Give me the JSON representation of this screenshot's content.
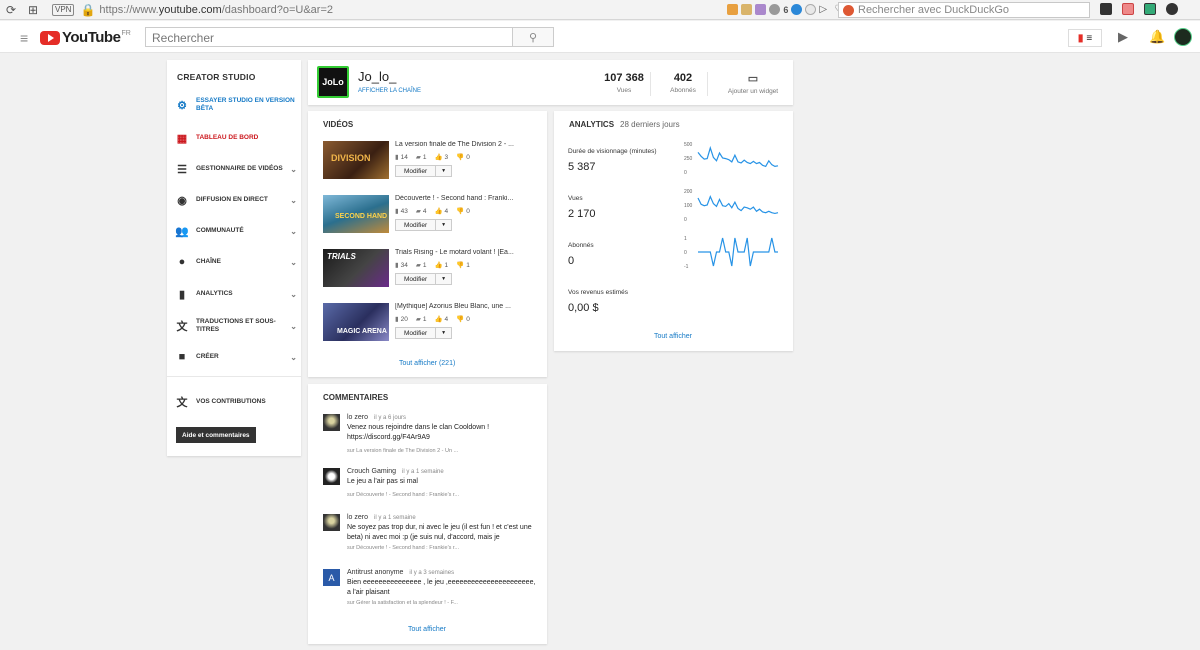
{
  "browser": {
    "vpn_label": "VPN",
    "url_prefix": "https://www.",
    "url_domain": "youtube.com",
    "url_path": "/dashboard?o=U&ar=2",
    "ext_badge": "6",
    "search_placeholder": "Rechercher avec DuckDuckGo"
  },
  "header": {
    "logo_text": "YouTube",
    "logo_region": "FR",
    "search_placeholder": "Rechercher"
  },
  "sidebar": {
    "title": "CREATOR STUDIO",
    "items": [
      {
        "label": "ESSAYER STUDIO EN VERSION BÊTA",
        "icon": "gear-icon"
      },
      {
        "label": "TABLEAU DE BORD",
        "icon": "dashboard-icon"
      },
      {
        "label": "GESTIONNAIRE DE VIDÉOS",
        "icon": "video-manager-icon"
      },
      {
        "label": "DIFFUSION EN DIRECT",
        "icon": "live-icon"
      },
      {
        "label": "COMMUNAUTÉ",
        "icon": "community-icon"
      },
      {
        "label": "CHAÎNE",
        "icon": "channel-icon"
      },
      {
        "label": "ANALYTICS",
        "icon": "analytics-icon"
      },
      {
        "label": "TRADUCTIONS ET SOUS-TITRES",
        "icon": "translate-icon"
      },
      {
        "label": "CRÉER",
        "icon": "create-icon"
      },
      {
        "label": "VOS CONTRIBUTIONS",
        "icon": "contributions-icon"
      }
    ],
    "help_button": "Aide et commentaires"
  },
  "channel": {
    "name": "Jo_lo_",
    "link": "AFFICHER LA CHAÎNE",
    "views_value": "107 368",
    "views_label": "Vues",
    "subs_value": "402",
    "subs_label": "Abonnés",
    "widget_label": "Ajouter un widget"
  },
  "videos": {
    "title": "VIDÉOS",
    "modify_label": "Modifier",
    "see_all": "Tout afficher (221)",
    "items": [
      {
        "title": "La version finale de The Division 2 - ...",
        "views": "14",
        "comments": "1",
        "likes": "3",
        "dislikes": "0",
        "thumb_color": "#5a3a22"
      },
      {
        "title": "Découverte ! - Second hand : Franki...",
        "views": "43",
        "comments": "4",
        "likes": "4",
        "dislikes": "0",
        "thumb_color": "#2b6f8e"
      },
      {
        "title": "Trials Rising - Le motard volant ! [Ea...",
        "views": "34",
        "comments": "1",
        "likes": "1",
        "dislikes": "1",
        "thumb_color": "#2a2a2a"
      },
      {
        "title": "[Mythique] Azorius Bleu Blanc, une ...",
        "views": "20",
        "comments": "1",
        "likes": "4",
        "dislikes": "0",
        "thumb_color": "#3a3f6e"
      }
    ]
  },
  "analytics": {
    "title": "ANALYTICS",
    "period": "28 derniers jours",
    "metrics": [
      {
        "label": "Durée de visionnage (minutes)",
        "value": "5 387",
        "ticks": [
          "500",
          "250",
          "0"
        ],
        "points": [
          350,
          280,
          230,
          240,
          430,
          260,
          200,
          340,
          250,
          240,
          220,
          180,
          300,
          180,
          160,
          210,
          170,
          150,
          190,
          150,
          170,
          120,
          100,
          200,
          130,
          100,
          110
        ]
      },
      {
        "label": "Vues",
        "value": "2 170",
        "ticks": [
          "200",
          "100",
          "0"
        ],
        "points": [
          150,
          105,
          95,
          100,
          160,
          110,
          90,
          140,
          95,
          90,
          110,
          80,
          120,
          75,
          60,
          85,
          80,
          70,
          85,
          55,
          70,
          50,
          45,
          55,
          45,
          40,
          45
        ]
      },
      {
        "label": "Abonnés",
        "value": "0",
        "ticks": [
          "1",
          "0",
          "-1"
        ],
        "points": [
          0,
          0,
          0,
          0,
          0,
          -1,
          0,
          0,
          1,
          0,
          0,
          -1,
          1,
          0,
          0,
          0,
          1,
          -1,
          0,
          0,
          0,
          0,
          0,
          0,
          1,
          0,
          0
        ]
      },
      {
        "label": "Vos revenus estimés",
        "value": "0,00 $"
      }
    ],
    "see_all": "Tout afficher",
    "line_color": "#2793e6"
  },
  "comments": {
    "title": "COMMENTAIRES",
    "see_all": "Tout afficher",
    "items": [
      {
        "author": "lo zero",
        "time": "il y a 6 jours",
        "text": "Venez nous rejoindre dans le clan Cooldown ! https://discord.gg/F4Ar9A9",
        "on": "sur La version finale de The Division 2 - Un ..."
      },
      {
        "author": "Crouch Gaming",
        "time": "il y a 1 semaine",
        "text": "Le jeu a l'air pas si mal",
        "on": "sur Découverte ! - Second hand : Frankie's r..."
      },
      {
        "author": "lo zero",
        "time": "il y a 1 semaine",
        "text": "Ne soyez pas trop dur, ni avec le jeu (il est fun ! et c'est une beta) ni avec moi :p (je suis nul, d'accord, mais je",
        "on": "sur Découverte ! - Second hand : Frankie's r..."
      },
      {
        "author": "Antitrust anonyme",
        "time": "il y a 3 semaines",
        "text": "Bien eeeeeeeeeeeeeee , le jeu ,eeeeeeeeeeeeeeeeeeeeee, a l'air plaisant",
        "on": "sur Gérer la satisfaction et la splendeur ! - F..."
      }
    ]
  }
}
